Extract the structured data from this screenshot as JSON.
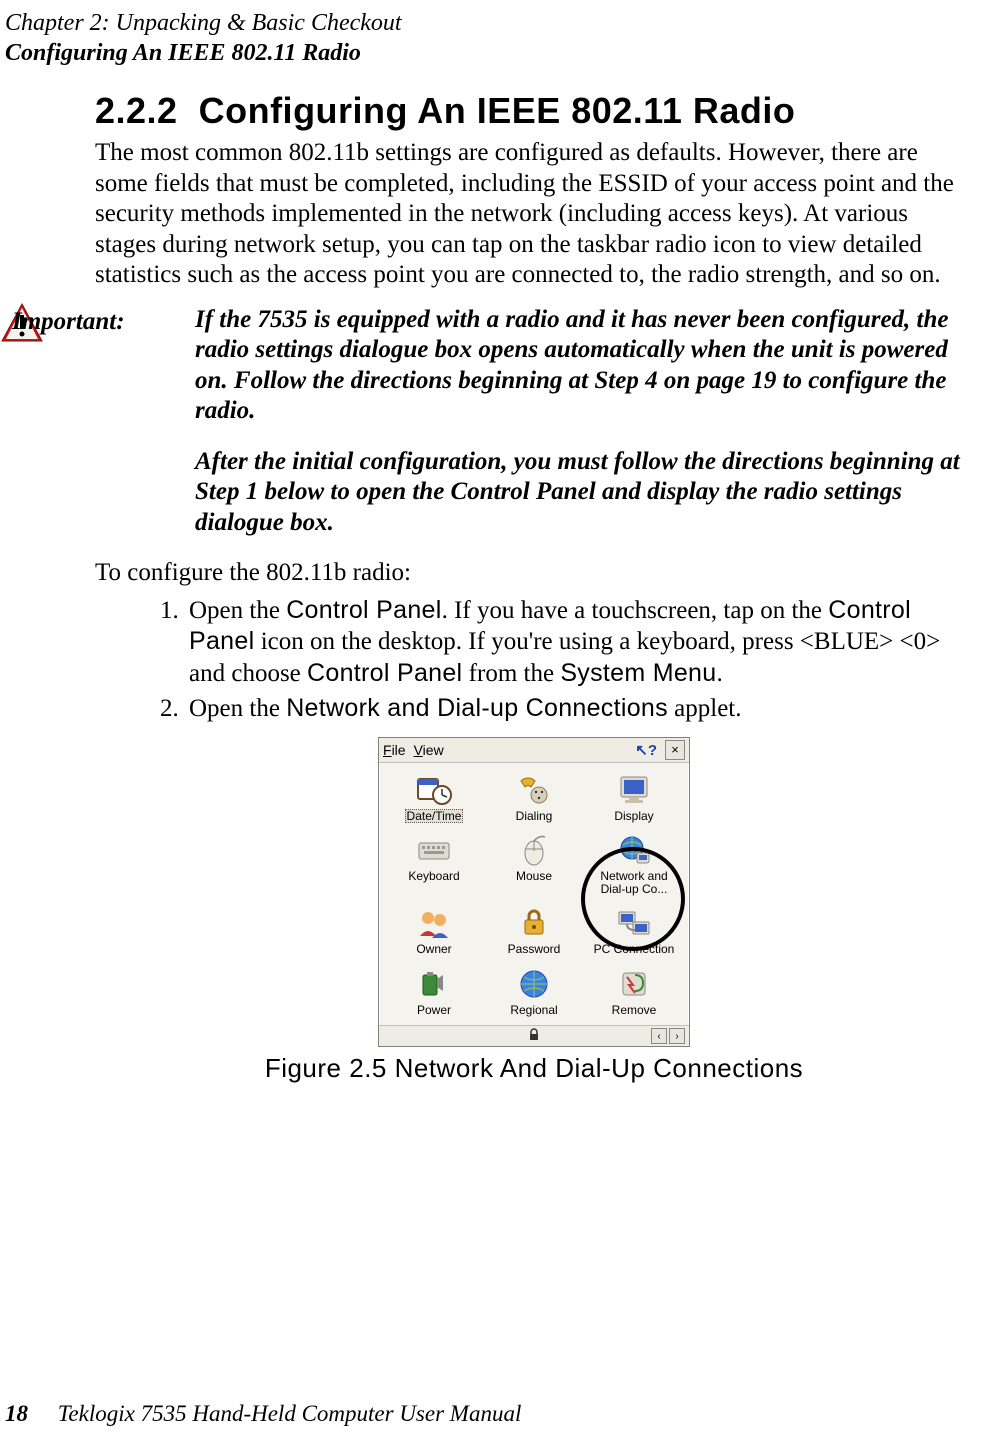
{
  "header": {
    "chapter_line": "Chapter  2:  Unpacking & Basic Checkout",
    "subhead": "Configuring An IEEE 802.11 Radio"
  },
  "section": {
    "number": "2.2.2",
    "title": "Configuring An IEEE 802.11 Radio"
  },
  "paragraphs": {
    "intro": "The most common 802.11b settings are configured as defaults. However, there are some fields that must be completed, including the ESSID of your access point and the security methods implemented in the network (including access keys). At various stages during network setup, you can tap on the taskbar radio icon to view detailed statistics such as the access point you are connected to, the radio strength, and so on.",
    "instr": "To configure the 802.11b radio:"
  },
  "important": {
    "label": "Important:",
    "p1": "If the 7535 is equipped with a radio and it has never been configured, the radio settings dialogue box opens automatically when the unit is powered on. Follow the directions beginning at Step 4 on page 19 to configure the radio.",
    "p2": "After the initial configuration, you must follow the directions beginning at Step 1 below to open the Control Panel and display the radio settings dialogue box."
  },
  "steps": {
    "s1a": "Open the ",
    "s1_ui1": "Control Panel",
    "s1b": ". If you have a touchscreen, tap on the ",
    "s1_ui2": "Control Panel",
    "s1c": " icon on the desktop. If you're using a keyboard, press <BLUE> <0> and choose ",
    "s1_ui3": "Control Panel",
    "s1d": " from the ",
    "s1_ui4": "System Menu",
    "s1e": ".",
    "s2a": "Open the ",
    "s2_ui1": "Network and Dial-up Connections",
    "s2b": " applet."
  },
  "figure": {
    "caption": "Figure 2.5 Network And Dial-Up Connections"
  },
  "control_panel": {
    "menu": {
      "file": "File",
      "view": "View",
      "help": "?",
      "close": "×"
    },
    "items": [
      {
        "label": "Date/Time",
        "selected": true,
        "icon": "datetime"
      },
      {
        "label": "Dialing",
        "selected": false,
        "icon": "dialing"
      },
      {
        "label": "Display",
        "selected": false,
        "icon": "display"
      },
      {
        "label": "Keyboard",
        "selected": false,
        "icon": "keyboard"
      },
      {
        "label": "Mouse",
        "selected": false,
        "icon": "mouse"
      },
      {
        "label": "Network and Dial-up Co...",
        "selected": false,
        "icon": "network"
      },
      {
        "label": "Owner",
        "selected": false,
        "icon": "owner"
      },
      {
        "label": "Password",
        "selected": false,
        "icon": "password"
      },
      {
        "label": "PC Connection",
        "selected": false,
        "icon": "pcconn"
      },
      {
        "label": "Power",
        "selected": false,
        "icon": "power"
      },
      {
        "label": "Regional",
        "selected": false,
        "icon": "regional"
      },
      {
        "label": "Remove",
        "selected": false,
        "icon": "remove"
      }
    ]
  },
  "footer": {
    "page": "18",
    "book": "Teklogix 7535 Hand-Held Computer User Manual"
  }
}
